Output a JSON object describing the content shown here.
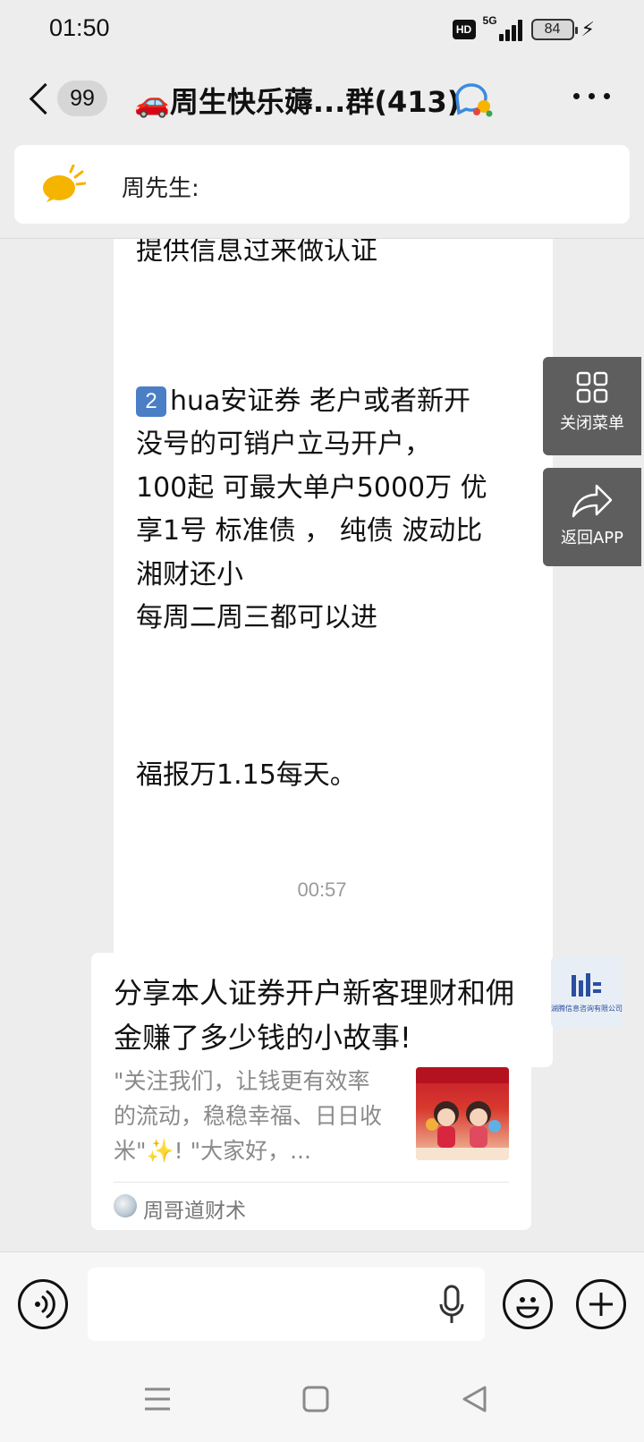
{
  "status_bar": {
    "time": "01:50",
    "hd": "HD",
    "network": "5G",
    "battery": "84"
  },
  "header": {
    "unread_count": "99",
    "title": "🚗周生快乐薅...群(413)"
  },
  "pinned": {
    "text": "周先生:"
  },
  "long_message": {
    "line_partial": "提供信息过来做认证",
    "item_number": "2",
    "line1": "hua安证券 老户或者新开",
    "line2": "没号的可销户立马开户，",
    "line3": "100起 可最大单户5000万  优",
    "line4": "享1号 标准债 ， 纯债 波动比",
    "line5": "湘财还小",
    "line6": "每周二周三都可以进",
    "line7": "福报万1.15每天。"
  },
  "timestamp": "00:57",
  "share_card": {
    "title": "分享本人证券开户新客理财和佣金赚了多少钱的小故事!",
    "desc": "\"关注我们，让钱更有效率的流动，稳稳幸福、日日收米\"✨! \"大家好，...",
    "source": "周哥道财术"
  },
  "sender_avatar": {
    "company": "湖腾信息咨询有限公司"
  },
  "float_panel": {
    "close_menu": "关闭菜单",
    "back_app": "返回APP"
  },
  "colors": {
    "background": "#ededed",
    "bubble": "#ffffff",
    "float_panel": "#5e5e5e",
    "number_badge": "#4a7fc6"
  }
}
